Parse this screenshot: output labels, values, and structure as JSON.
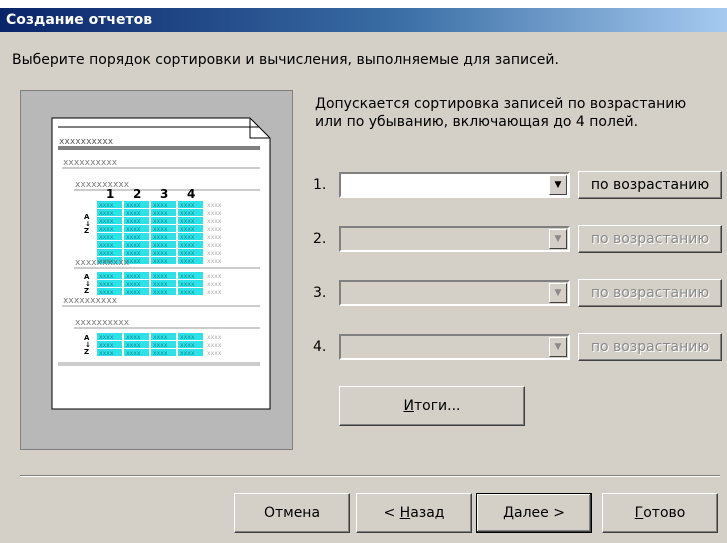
{
  "window": {
    "title": "Создание отчетов"
  },
  "instruction": "Выберите порядок сортировки и вычисления, выполняемые для записей.",
  "description": {
    "line1": "Допускается сортировка записей по возрастанию",
    "line2": "или по убыванию, включающая до 4 полей."
  },
  "preview": {
    "group_label": "xxxxxxxxxx",
    "column_numbers": [
      "1",
      "2",
      "3",
      "4"
    ],
    "cell_text": "xxxx"
  },
  "sort_rows": [
    {
      "number": "1.",
      "value": "",
      "order_label": "по возрастанию",
      "enabled": true
    },
    {
      "number": "2.",
      "value": "",
      "order_label": "по возрастанию",
      "enabled": false
    },
    {
      "number": "3.",
      "value": "",
      "order_label": "по возрастанию",
      "enabled": false
    },
    {
      "number": "4.",
      "value": "",
      "order_label": "по возрастанию",
      "enabled": false
    }
  ],
  "totals_button": {
    "mnemonic": "И",
    "rest": "тоги..."
  },
  "buttons": {
    "cancel": "Отмена",
    "back": {
      "prefix": "< ",
      "mnemonic": "Н",
      "rest": "азад"
    },
    "next": {
      "mnemonic": "Д",
      "rest": "алее >"
    },
    "finish": {
      "mnemonic": "Г",
      "rest": "отово"
    }
  }
}
